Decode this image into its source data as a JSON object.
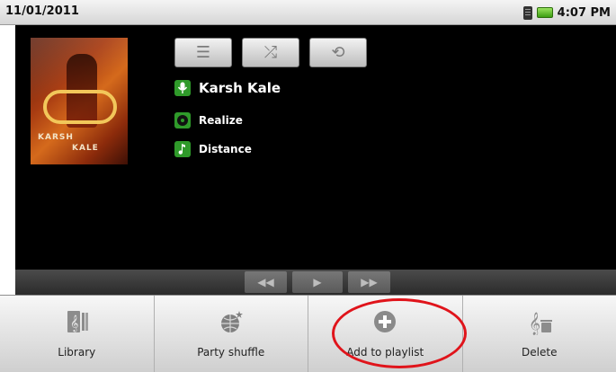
{
  "status_bar": {
    "date": "11/01/2011",
    "time": "4:07 PM"
  },
  "now_playing": {
    "album_art": {
      "line1": "KARSH",
      "line2": "KALE"
    },
    "controls": [
      {
        "icon": "list-icon",
        "glyph": "☰"
      },
      {
        "icon": "shuffle-icon",
        "glyph": "⤮"
      },
      {
        "icon": "repeat-icon",
        "glyph": "⟲"
      }
    ],
    "artist": "Karsh Kale",
    "album": "Realize",
    "track": "Distance"
  },
  "transport": {
    "prev": "◀◀",
    "play": "▶",
    "next": "▶▶"
  },
  "menu": {
    "items": [
      {
        "label": "Library",
        "icon": "library-icon"
      },
      {
        "label": "Party shuffle",
        "icon": "party-shuffle-icon"
      },
      {
        "label": "Add to playlist",
        "icon": "add-to-playlist-icon"
      },
      {
        "label": "Delete",
        "icon": "delete-icon"
      }
    ]
  },
  "colors": {
    "accent_green": "#2f9a2a",
    "highlight_red": "#e0141b"
  }
}
